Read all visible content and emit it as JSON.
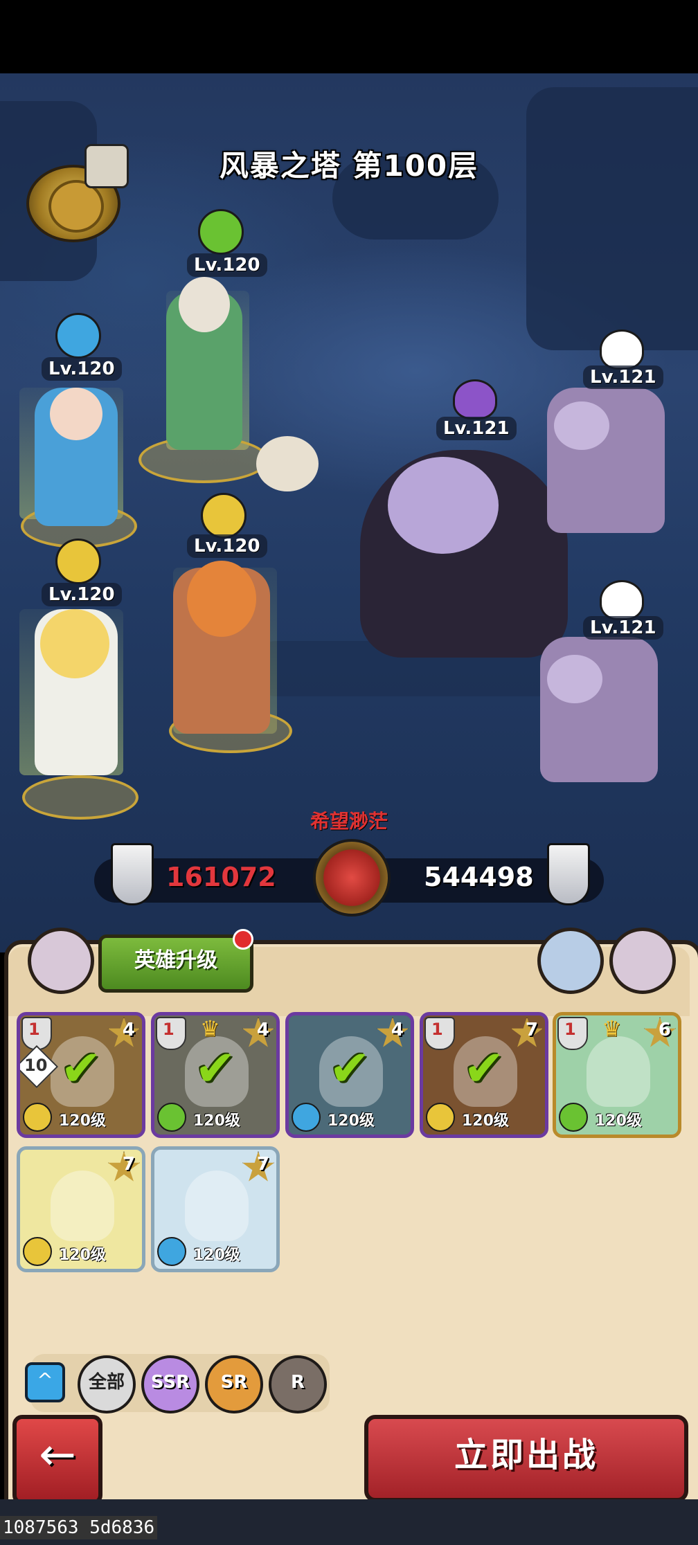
{
  "stage": {
    "title": "风暴之塔 第100层"
  },
  "allies": [
    {
      "level": "Lv.120",
      "element": "wind",
      "color": "#6ac232"
    },
    {
      "level": "Lv.120",
      "element": "water",
      "color": "#3fa6e0"
    },
    {
      "level": "Lv.120",
      "element": "earth",
      "color": "#e8c53a"
    },
    {
      "level": "Lv.120",
      "element": "earth",
      "color": "#e8c53a"
    }
  ],
  "enemies": [
    {
      "level": "Lv.121",
      "type": "demon"
    },
    {
      "level": "Lv.121",
      "type": "skull"
    },
    {
      "level": "Lv.121",
      "type": "skull"
    }
  ],
  "battle": {
    "fate_label": "希望渺茫",
    "our_power": "161072",
    "enemy_power": "544498"
  },
  "panel": {
    "upgrade_label": "英雄升级",
    "cards": [
      {
        "level": "120级",
        "stars": "4",
        "shield": "1",
        "badge": "10",
        "selected": true,
        "element_color": "#e8c53a",
        "bg": "#8a6a3a"
      },
      {
        "level": "120级",
        "stars": "4",
        "shield": "1",
        "selected": true,
        "crown": true,
        "element_color": "#6ac232",
        "bg": "#6a6a5e"
      },
      {
        "level": "120级",
        "stars": "4",
        "selected": true,
        "element_color": "#3fa6e0",
        "bg": "#4c6a78"
      },
      {
        "level": "120级",
        "stars": "7",
        "shield": "1",
        "selected": true,
        "element_color": "#e8c53a",
        "bg": "#7a5230"
      },
      {
        "level": "120级",
        "stars": "6",
        "shield": "1",
        "crown": true,
        "element_color": "#6ac232",
        "bg": "#9ed1a8"
      },
      {
        "level": "120级",
        "stars": "7",
        "element_color": "#e8c53a",
        "bg": "#efe7a0"
      },
      {
        "level": "120级",
        "stars": "7",
        "element_color": "#3fa6e0",
        "bg": "#cfe3ee"
      }
    ],
    "filters": [
      "全部",
      "SSR",
      "SR",
      "R"
    ],
    "fight_label": "立即出战"
  },
  "build_id": "1087563 5d6836"
}
